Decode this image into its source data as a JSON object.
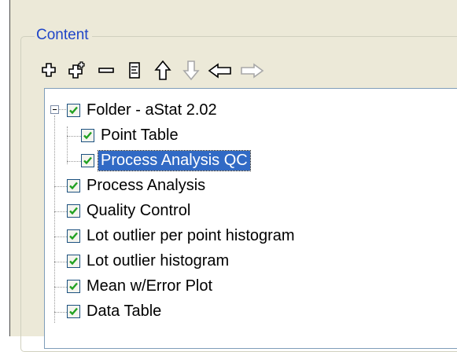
{
  "group": {
    "title": "Content"
  },
  "toolbar": {
    "buttons": [
      {
        "name": "add-item-button",
        "icon": "plus-icon",
        "enabled": true
      },
      {
        "name": "add-child-button",
        "icon": "plus-child-icon",
        "enabled": true
      },
      {
        "name": "remove-button",
        "icon": "minus-icon",
        "enabled": true
      },
      {
        "name": "properties-button",
        "icon": "list-document-icon",
        "enabled": true
      },
      {
        "name": "move-up-button",
        "icon": "arrow-up-icon",
        "enabled": true
      },
      {
        "name": "move-down-button",
        "icon": "arrow-down-icon",
        "enabled": false
      },
      {
        "name": "move-left-button",
        "icon": "arrow-left-icon",
        "enabled": true
      },
      {
        "name": "move-right-button",
        "icon": "arrow-right-icon",
        "enabled": false
      }
    ]
  },
  "tree": {
    "items": [
      {
        "label": "Folder - aStat 2.02",
        "checked": true,
        "level": 0,
        "expanded": true
      },
      {
        "label": "Point Table",
        "checked": true,
        "level": 1
      },
      {
        "label": "Process Analysis QC",
        "checked": true,
        "level": 1,
        "selected": true
      },
      {
        "label": "Process Analysis",
        "checked": true,
        "level": 0
      },
      {
        "label": "Quality Control",
        "checked": true,
        "level": 0
      },
      {
        "label": "Lot outlier per point histogram",
        "checked": true,
        "level": 0
      },
      {
        "label": "Lot outlier histogram",
        "checked": true,
        "level": 0
      },
      {
        "label": "Mean w/Error Plot",
        "checked": true,
        "level": 0
      },
      {
        "label": "Data Table",
        "checked": true,
        "level": 0
      }
    ]
  },
  "colors": {
    "panel_bg": "#ece9d8",
    "legend_text": "#1f45c8",
    "selection_bg": "#316ac5",
    "checkmark": "#21a121",
    "arrow_enabled": "#000000",
    "arrow_disabled": "#a8a8a8"
  }
}
